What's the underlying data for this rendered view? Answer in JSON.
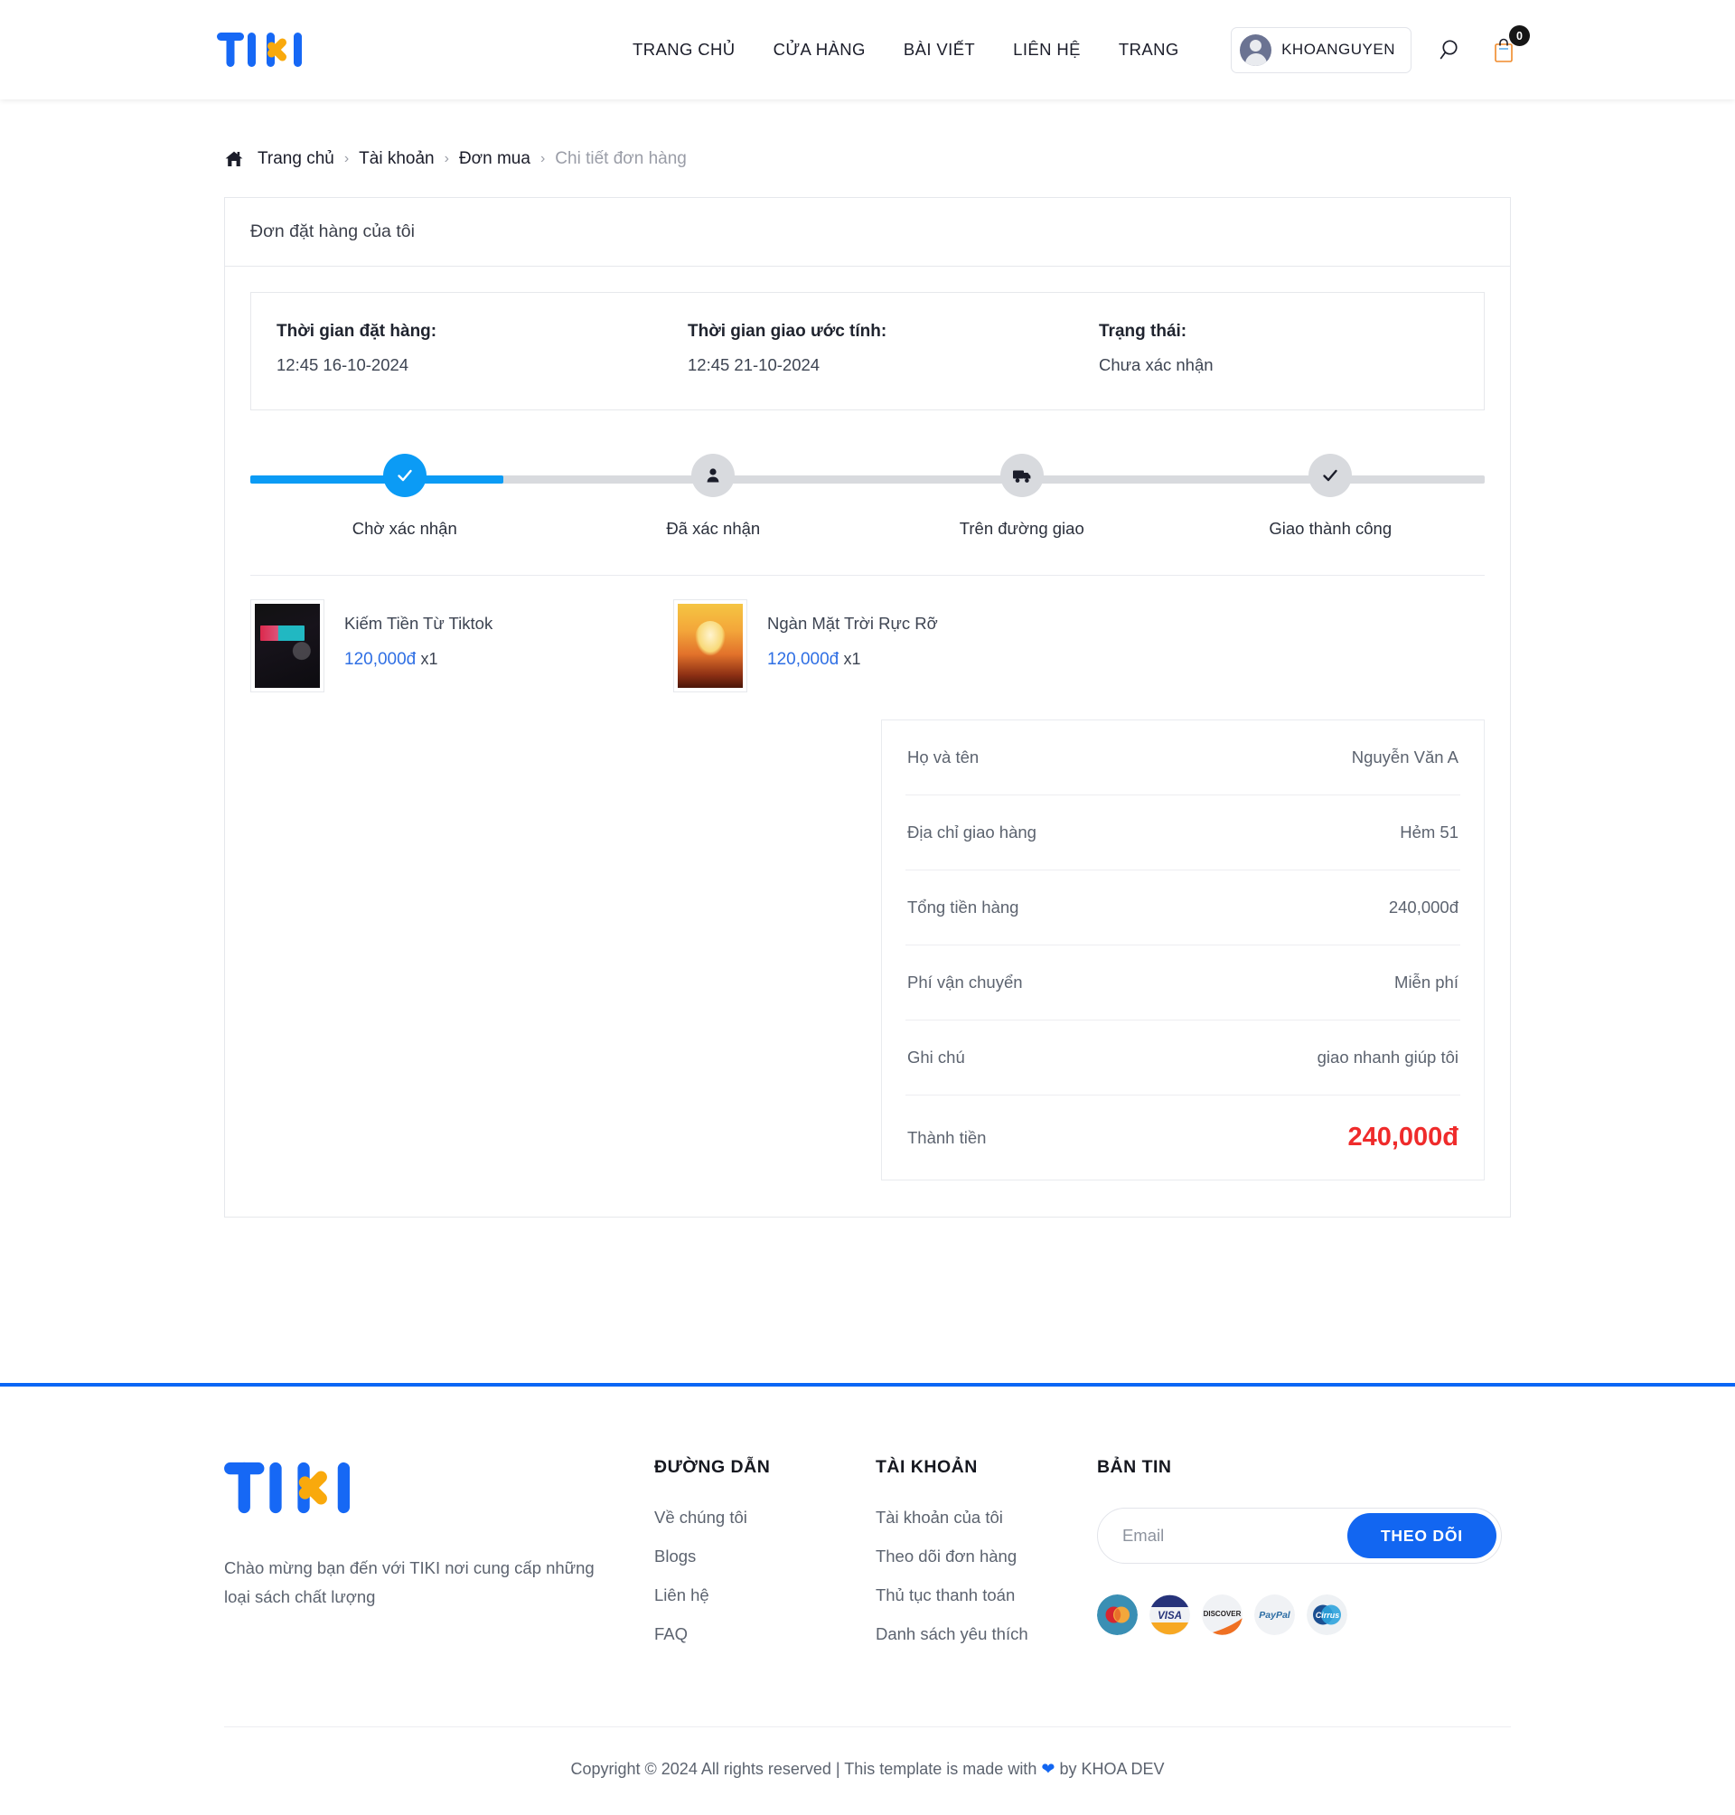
{
  "header": {
    "logo_text": "TIKI",
    "nav": [
      {
        "label": "TRANG CHỦ"
      },
      {
        "label": "CỬA HÀNG"
      },
      {
        "label": "BÀI VIẾT"
      },
      {
        "label": "LIÊN HỆ"
      },
      {
        "label": "TRANG"
      }
    ],
    "user_name": "KHOANGUYEN",
    "search_icon": "search-icon",
    "cart_icon": "shopping-bag-icon",
    "cart_count": "0"
  },
  "breadcrumb": {
    "home_icon": "home-icon",
    "items": [
      {
        "label": "Trang chủ",
        "current": false
      },
      {
        "label": "Tài khoản",
        "current": false
      },
      {
        "label": "Đơn mua",
        "current": false
      },
      {
        "label": "Chi tiết đơn hàng",
        "current": true
      }
    ],
    "separator": "›"
  },
  "order": {
    "card_title": "Đơn đặt hàng của tôi",
    "meta": [
      {
        "label": "Thời gian đặt hàng:",
        "value": "12:45 16-10-2024"
      },
      {
        "label": "Thời gian giao ước tính:",
        "value": "12:45 21-10-2024"
      },
      {
        "label": "Trạng thái:",
        "value": "Chưa xác nhận"
      }
    ],
    "steps": [
      {
        "label": "Chờ xác nhận",
        "icon": "check-icon",
        "active": true
      },
      {
        "label": "Đã xác nhận",
        "icon": "person-icon",
        "active": false
      },
      {
        "label": "Trên đường giao",
        "icon": "truck-icon",
        "active": false
      },
      {
        "label": "Giao thành công",
        "icon": "check-icon",
        "active": false
      }
    ],
    "progress_percent": "20.5",
    "products": [
      {
        "title": "Kiếm Tiền Từ Tiktok",
        "price": "120,000đ",
        "qty": "x1",
        "cover": "book-a"
      },
      {
        "title": "Ngàn Mặt Trời Rực Rỡ",
        "price": "120,000đ",
        "qty": "x1",
        "cover": "book-b"
      }
    ],
    "summary": [
      {
        "label": "Họ và tên",
        "value": "Nguyễn Văn A"
      },
      {
        "label": "Địa chỉ giao hàng",
        "value": "Hẻm 51"
      },
      {
        "label": "Tổng tiền hàng",
        "value": "240,000đ"
      },
      {
        "label": "Phí vận chuyển",
        "value": "Miễn phí"
      },
      {
        "label": "Ghi chú",
        "value": "giao nhanh giúp tôi"
      },
      {
        "label": "Thành tiền",
        "value": "240,000đ"
      }
    ]
  },
  "footer": {
    "logo_text": "TIKI",
    "brand_desc": "Chào mừng bạn đến với TIKI nơi cung cấp những loại sách chất lượng",
    "links_title": "ĐƯỜNG DẪN",
    "links": [
      {
        "label": "Về chúng tôi"
      },
      {
        "label": "Blogs"
      },
      {
        "label": "Liên hệ"
      },
      {
        "label": "FAQ"
      }
    ],
    "account_title": "TÀI KHOẢN",
    "account_links": [
      {
        "label": "Tài khoản của tôi"
      },
      {
        "label": "Theo dõi đơn hàng"
      },
      {
        "label": "Thủ tục thanh toán"
      },
      {
        "label": "Danh sách yêu thích"
      }
    ],
    "news_title": "BẢN TIN",
    "email_placeholder": "Email",
    "email_value": "",
    "subscribe_label": "THEO DÕI",
    "payment_icons": [
      {
        "name": "mastercard-icon"
      },
      {
        "name": "visa-icon"
      },
      {
        "name": "discover-icon"
      },
      {
        "name": "paypal-icon"
      },
      {
        "name": "cirrus-icon"
      }
    ],
    "copyright_pre": "Copyright © 2024 All rights reserved | This template is made with",
    "copyright_post": "by KHOA DEV"
  },
  "colors": {
    "brand_blue": "#0a66f5",
    "logo_blue": "#1668f5",
    "logo_orange": "#f9a90c",
    "progress_blue": "#0b9bf5",
    "price_blue": "#2f6fe4",
    "total_red": "#ef2b2b"
  }
}
